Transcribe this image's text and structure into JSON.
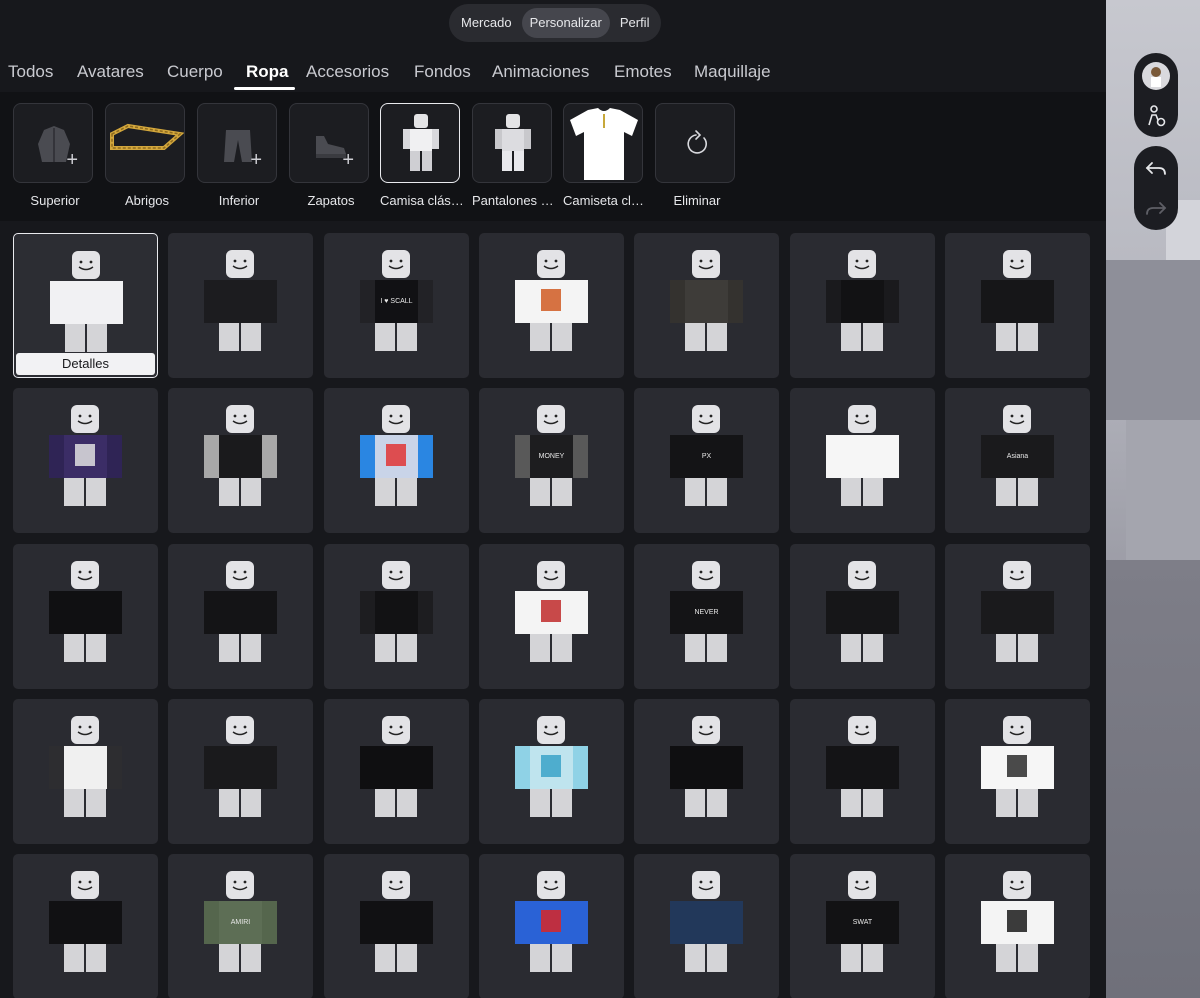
{
  "segmented": [
    {
      "label": "Mercado",
      "active": false
    },
    {
      "label": "Personalizar",
      "active": true
    },
    {
      "label": "Perfil",
      "active": false
    }
  ],
  "tabs": [
    {
      "label": "Todos",
      "active": false
    },
    {
      "label": "Avatares",
      "active": false
    },
    {
      "label": "Cuerpo",
      "active": false
    },
    {
      "label": "Ropa",
      "active": true
    },
    {
      "label": "Accesorios",
      "active": false
    },
    {
      "label": "Fondos",
      "active": false
    },
    {
      "label": "Animaciones",
      "active": false
    },
    {
      "label": "Emotes",
      "active": false
    },
    {
      "label": "Maquillaje",
      "active": false
    }
  ],
  "subcategories": [
    {
      "label": "Superior",
      "icon": "jacket-icon"
    },
    {
      "label": "Abrigos",
      "icon": "gold-chain-thumbnail"
    },
    {
      "label": "Inferior",
      "icon": "pants-icon"
    },
    {
      "label": "Zapatos",
      "icon": "shoe-icon"
    },
    {
      "label": "Camisa clási...",
      "icon": "classic-shirt-avatar",
      "selected": true
    },
    {
      "label": "Pantalones c...",
      "icon": "classic-pants-avatar"
    },
    {
      "label": "Camiseta clá...",
      "icon": "tshirt-thumbnail"
    },
    {
      "label": "Eliminar",
      "icon": "reset-icon"
    }
  ],
  "details_label": "Detalles",
  "items": [
    {
      "shirt": "#f1f1f3",
      "sleeve": "#f1f1f3",
      "print": ""
    },
    {
      "shirt": "#1c1c1f",
      "sleeve": "#1c1c1f",
      "print": ""
    },
    {
      "shirt": "#111114",
      "sleeve": "#222226",
      "print": "I ♥ SCALL"
    },
    {
      "shirt": "#f4f4f4",
      "sleeve": "#f4f4f4",
      "print": "",
      "graphic": "#d05a22"
    },
    {
      "shirt": "#3e3c39",
      "sleeve": "#34322f",
      "print": ""
    },
    {
      "shirt": "#121214",
      "sleeve": "#1a1a1d",
      "print": ""
    },
    {
      "shirt": "#161618",
      "sleeve": "#161618",
      "print": ""
    },
    {
      "shirt": "#3b2d66",
      "sleeve": "#2f2455",
      "print": "",
      "graphic": "#e0e0e0"
    },
    {
      "shirt": "#1a1a1c",
      "sleeve": "#a8a8a8",
      "print": ""
    },
    {
      "shirt": "#c9d4e8",
      "sleeve": "#2a86e2",
      "print": "",
      "graphic": "#e03535"
    },
    {
      "shirt": "#1d1d1f",
      "sleeve": "#595959",
      "print": "MONEY"
    },
    {
      "shirt": "#141416",
      "sleeve": "#141416",
      "print": "PX"
    },
    {
      "shirt": "#f6f6f6",
      "sleeve": "#f6f6f6",
      "print": ""
    },
    {
      "shirt": "#1a1a1c",
      "sleeve": "#1a1a1c",
      "print": "Asiana"
    },
    {
      "shirt": "#101012",
      "sleeve": "#101012",
      "print": ""
    },
    {
      "shirt": "#141416",
      "sleeve": "#141416",
      "print": ""
    },
    {
      "shirt": "#121214",
      "sleeve": "#1d1d20",
      "print": ""
    },
    {
      "shirt": "#f4f4f4",
      "sleeve": "#f4f4f4",
      "print": "",
      "graphic": "#c02a2a"
    },
    {
      "shirt": "#141416",
      "sleeve": "#141416",
      "print": "NEVER"
    },
    {
      "shirt": "#161618",
      "sleeve": "#161618",
      "print": ""
    },
    {
      "shirt": "#1a1a1c",
      "sleeve": "#1a1a1c",
      "print": ""
    },
    {
      "shirt": "#f0f0f0",
      "sleeve": "#2d2d30",
      "print": ""
    },
    {
      "shirt": "#1a1a1c",
      "sleeve": "#1a1a1c",
      "print": ""
    },
    {
      "shirt": "#0f0f11",
      "sleeve": "#0f0f11",
      "print": ""
    },
    {
      "shirt": "#bfe4ee",
      "sleeve": "#8fd2e6",
      "print": "",
      "graphic": "#3aa3c8"
    },
    {
      "shirt": "#0f0f11",
      "sleeve": "#0f0f11",
      "print": ""
    },
    {
      "shirt": "#141416",
      "sleeve": "#141416",
      "print": ""
    },
    {
      "shirt": "#f6f6f6",
      "sleeve": "#f6f6f6",
      "print": "",
      "graphic": "#2b2b2b"
    },
    {
      "shirt": "#111113",
      "sleeve": "#111113",
      "print": ""
    },
    {
      "shirt": "#5d6e55",
      "sleeve": "#55664d",
      "print": "AMIRI"
    },
    {
      "shirt": "#111113",
      "sleeve": "#111113",
      "print": ""
    },
    {
      "shirt": "#2a62d6",
      "sleeve": "#2a62d6",
      "print": "",
      "graphic": "#d82727"
    },
    {
      "shirt": "#22385a",
      "sleeve": "#22385a",
      "print": ""
    },
    {
      "shirt": "#121214",
      "sleeve": "#121214",
      "print": "SWAT"
    },
    {
      "shirt": "#f4f4f4",
      "sleeve": "#f4f4f4",
      "print": "",
      "graphic": "#1a1a1a"
    }
  ]
}
